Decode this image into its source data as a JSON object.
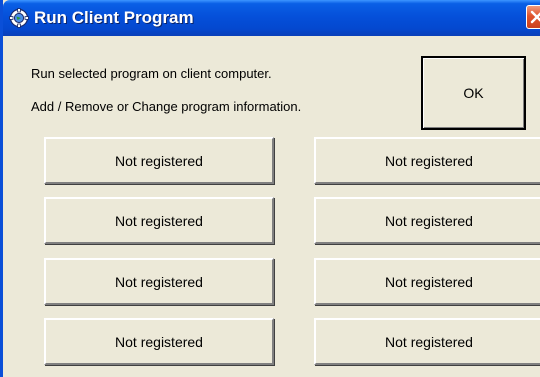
{
  "window": {
    "title": "Run Client Program",
    "title_icon": "gear-globe-icon",
    "close_icon": "close-icon"
  },
  "description": {
    "line1": "Run selected program on client computer.",
    "line2": "Add / Remove or Change program information."
  },
  "ok_label": "OK",
  "programs": [
    {
      "label": "Not registered"
    },
    {
      "label": "Not registered"
    },
    {
      "label": "Not registered"
    },
    {
      "label": "Not registered"
    },
    {
      "label": "Not registered"
    },
    {
      "label": "Not registered"
    },
    {
      "label": "Not registered"
    },
    {
      "label": "Not registered"
    }
  ],
  "colors": {
    "titlebar": "#0550da",
    "face": "#ece9d8",
    "close": "#e0542c"
  }
}
